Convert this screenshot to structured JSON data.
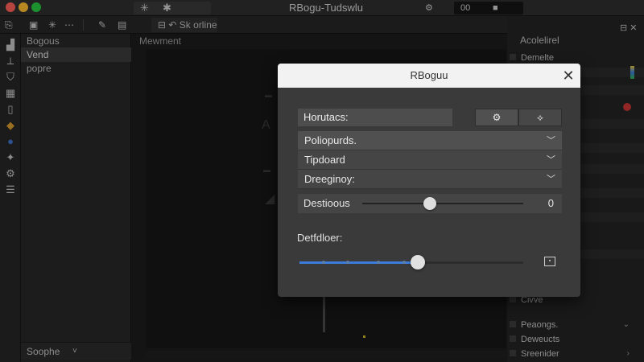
{
  "titlebar": {
    "title": "RBogu-Tudswlu",
    "group_icons": [
      "sparkle-icon",
      "asterisk-icon"
    ],
    "controls": [
      "gear-icon",
      "00",
      "square-icon"
    ]
  },
  "toolbar": {
    "items": [
      "file-icon",
      "save-icon",
      "asterisk-icon",
      "more-icon",
      "puzzle-icon",
      "layers-icon"
    ],
    "input_prefix": "Sk",
    "input_value": "orline"
  },
  "sidebar": {
    "items": [
      {
        "label": "Bogous",
        "selected": false
      },
      {
        "label": "Vend",
        "selected": true
      },
      {
        "label": "popre",
        "selected": false
      }
    ],
    "footer": "Soophe",
    "footer_chevron": "˅"
  },
  "canvas": {
    "title": "Mewment"
  },
  "right_panel": {
    "header": "Acolelirel",
    "rows": [
      "Demelte",
      "Civve",
      "Peaongs.",
      "Deweucts",
      "Sreenider"
    ]
  },
  "dialog": {
    "title": "RBoguu",
    "close_glyph": "✕",
    "field_label": "Horutacs:",
    "seg_icons": [
      "gear-icon",
      "diamond-icon"
    ],
    "dropdowns": [
      {
        "value": "Poliopurds.",
        "chevron": "⌄"
      },
      {
        "value": "Tipdoard",
        "chevron": "⌄"
      },
      {
        "value": "Dreeginoy:",
        "chevron": "⌄"
      }
    ],
    "slider": {
      "label": "Destioous",
      "value": "0",
      "fraction": 0.42
    },
    "section_label": "Detfdloer:",
    "range_fraction": 0.53,
    "range_icon": "image-icon",
    "colors": {
      "accent": "#3c7bd9",
      "header_bg": "#f2f2f2",
      "panel_bg": "#3a3a3a"
    }
  }
}
